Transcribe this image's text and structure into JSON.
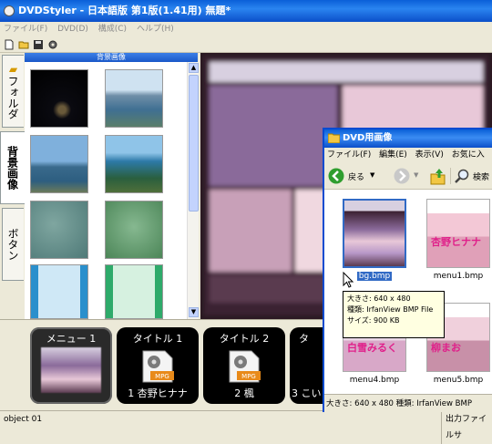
{
  "app": {
    "title": "DVDStyler - 日本語版 第1版(1.41用) 無題*"
  },
  "menubar": [
    "ファイル(F)",
    "DVD(D)",
    "構成(C)",
    "ヘルプ(H)"
  ],
  "side_tabs": {
    "folder": "フォルダ",
    "backgrounds": "背景画像",
    "buttons": "ボタン"
  },
  "panel": {
    "header": "背景画像"
  },
  "bottom": {
    "items": [
      {
        "top": "メニュー 1",
        "bottom": ""
      },
      {
        "top": "タイトル 1",
        "bottom": "1 杏野ヒナナ",
        "badge": "MPG"
      },
      {
        "top": "タイトル 2",
        "bottom": "2 楓",
        "badge": "MPG"
      },
      {
        "top": "タ",
        "bottom": "3 こい",
        "badge": ""
      }
    ]
  },
  "status": {
    "left": "object 01",
    "right": "出力ファイルサ"
  },
  "explorer": {
    "title": "DVD用画像",
    "menu": [
      "ファイル(F)",
      "編集(E)",
      "表示(V)",
      "お気に入"
    ],
    "back": "戻る",
    "search": "検索",
    "files": [
      {
        "label": "bg.bmp",
        "overlay": ""
      },
      {
        "label": "menu1.bmp",
        "overlay": "杏野ヒナナ"
      },
      {
        "label": "menu4.bmp",
        "overlay": "白雪みるく"
      },
      {
        "label": "menu5.bmp",
        "overlay": "柳まお"
      }
    ],
    "status": "大きさ: 640 x 480 種類: IrfanView BMP"
  },
  "tooltip": {
    "line1": "大きさ: 640 x 480",
    "line2": "種類: IrfanView BMP File",
    "line3": "サイズ: 900 KB"
  },
  "colors": {
    "titlebar": "#0b55d8",
    "selection": "#316ac5",
    "menu_bg": "#000000",
    "tooltip_bg": "#ffffe1"
  }
}
